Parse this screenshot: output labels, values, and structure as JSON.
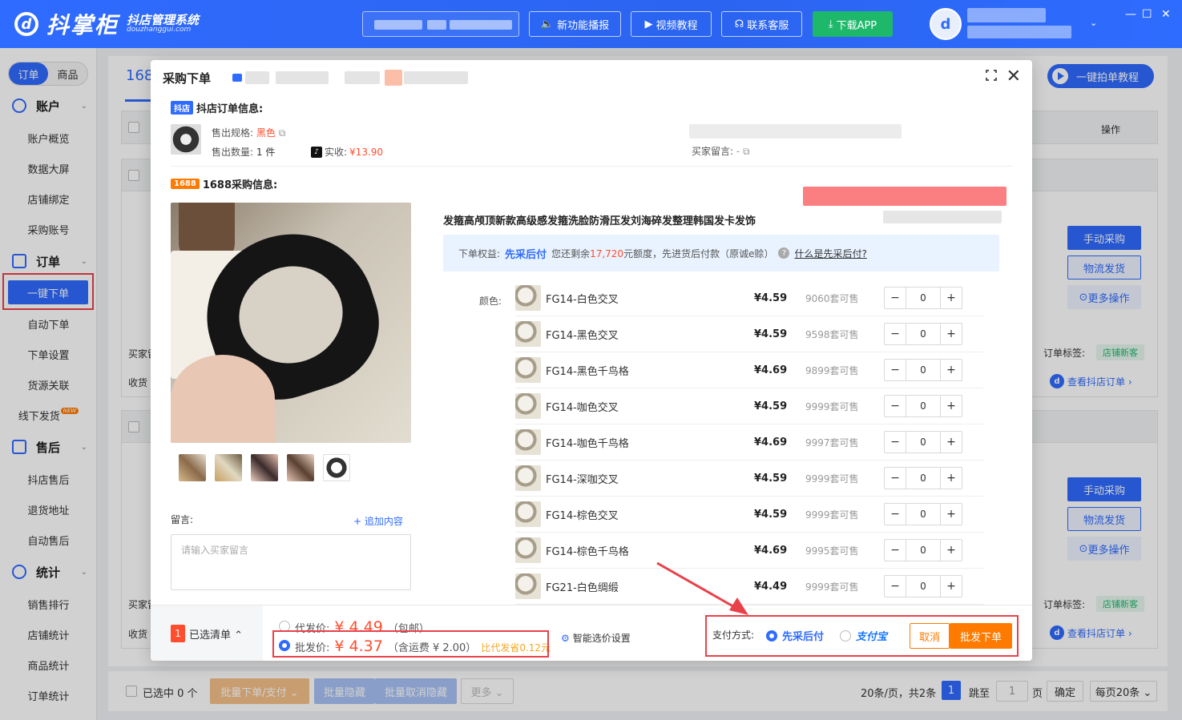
{
  "app": {
    "logo_text": "抖掌柜",
    "logo_sub_cn": "抖店管理系统",
    "logo_sub_en": "douzhanggui.com"
  },
  "topbar": {
    "buttons": [
      {
        "label": "新功能播报",
        "icon": "speaker-icon"
      },
      {
        "label": "视频教程",
        "icon": "video-icon"
      },
      {
        "label": "联系客服",
        "icon": "headset-icon"
      },
      {
        "label": "下载APP",
        "icon": "download-icon"
      }
    ],
    "window": {
      "minimize": "—",
      "maximize": "☐",
      "close": "✕"
    }
  },
  "sidebar": {
    "segments": [
      "订单",
      "商品"
    ],
    "groups": [
      {
        "label": "账户",
        "items": [
          "账户概览",
          "数据大屏",
          "店铺绑定",
          "采购账号"
        ]
      },
      {
        "label": "订单",
        "items": [
          "一键下单",
          "自动下单",
          "下单设置",
          "货源关联",
          "线下发货"
        ]
      },
      {
        "label": "售后",
        "items": [
          "抖店售后",
          "退货地址",
          "自动售后"
        ]
      },
      {
        "label": "统计",
        "items": [
          "销售排行",
          "店铺统计",
          "商品统计",
          "订单统计"
        ]
      }
    ],
    "new_badge": "NEW",
    "active_item": "一键下单"
  },
  "background": {
    "tab_label": "168",
    "tutorial_label": "一键拍单教程",
    "column_op": "操作",
    "buyer_label": "买家留",
    "receiver_label": "收货",
    "order_tag_label": "订单标签:",
    "order_tag": "店铺新客",
    "view_order_link": "查看抖店订单 ›",
    "btn_manual": "手动采购",
    "btn_logistics": "物流发货",
    "btn_more": "更多操作"
  },
  "footer": {
    "selected": "已选中 0 个",
    "batch_order": "批量下单/支付 ⌄",
    "batch_hide": "批量隐藏",
    "batch_unhide": "批量取消隐藏",
    "more": "更多 ⌄",
    "paging_info": "20条/页，共2条",
    "current_page": "1",
    "jump_label": "跳至",
    "jump_value": "1",
    "page_unit": "页",
    "confirm": "确定",
    "page_size": "每页20条 ⌄"
  },
  "modal": {
    "title": "采购下单",
    "store_section": {
      "badge": "抖店",
      "title": "抖店订单信息:",
      "spec_label": "售出规格:",
      "spec_value": "黑色",
      "qty_label": "售出数量:",
      "qty_value": "1 件",
      "paid_label": "实收:",
      "paid_value": "¥13.90",
      "buyer_msg_label": "买家留言:",
      "buyer_msg_value": "-"
    },
    "purchase_section": {
      "badge": "1688",
      "title": "1688采购信息:",
      "product_title": "发箍高颅顶新款高级感发箍洗脸防滑压发刘海碎发整理韩国发卡发饰",
      "benefit_label": "下单权益:",
      "benefit_name": "先采后付",
      "benefit_text_1": "您还剩余",
      "benefit_amount": "17,720",
      "benefit_text_2": "元额度，先进货后付款（原诚e赊）",
      "benefit_link": "什么是先采后付?",
      "color_label": "颜色:",
      "skus": [
        {
          "name": "FG14-白色交叉",
          "price": "¥4.59",
          "stock": "9060套可售",
          "qty": "0"
        },
        {
          "name": "FG14-黑色交叉",
          "price": "¥4.59",
          "stock": "9598套可售",
          "qty": "0"
        },
        {
          "name": "FG14-黑色千鸟格",
          "price": "¥4.69",
          "stock": "9899套可售",
          "qty": "0"
        },
        {
          "name": "FG14-咖色交叉",
          "price": "¥4.59",
          "stock": "9999套可售",
          "qty": "0"
        },
        {
          "name": "FG14-咖色千鸟格",
          "price": "¥4.69",
          "stock": "9997套可售",
          "qty": "0"
        },
        {
          "name": "FG14-深咖交叉",
          "price": "¥4.59",
          "stock": "9999套可售",
          "qty": "0"
        },
        {
          "name": "FG14-棕色交叉",
          "price": "¥4.59",
          "stock": "9999套可售",
          "qty": "0"
        },
        {
          "name": "FG14-棕色千鸟格",
          "price": "¥4.69",
          "stock": "9995套可售",
          "qty": "0"
        },
        {
          "name": "FG21-白色绸缎",
          "price": "¥4.49",
          "stock": "9999套可售",
          "qty": "0"
        }
      ],
      "msg_label": "留言:",
      "add_content": "+ 追加内容",
      "msg_placeholder": "请输入买家留言"
    },
    "bottom": {
      "cart_count": "1",
      "cart_label": "已选清单 ⌃",
      "dropship_label": "代发价:",
      "dropship_price": "¥ 4.49",
      "dropship_note": "（包邮）",
      "wholesale_label": "批发价:",
      "wholesale_price": "¥ 4.37",
      "wholesale_note": "（含运费 ¥ 2.00）",
      "save_note": "比代发省0.12元",
      "smart_price": "智能选价设置",
      "pay_label": "支付方式:",
      "pay_option_1": "先采后付",
      "pay_option_2": "支付宝",
      "cancel": "取消",
      "submit": "批发下单"
    }
  }
}
